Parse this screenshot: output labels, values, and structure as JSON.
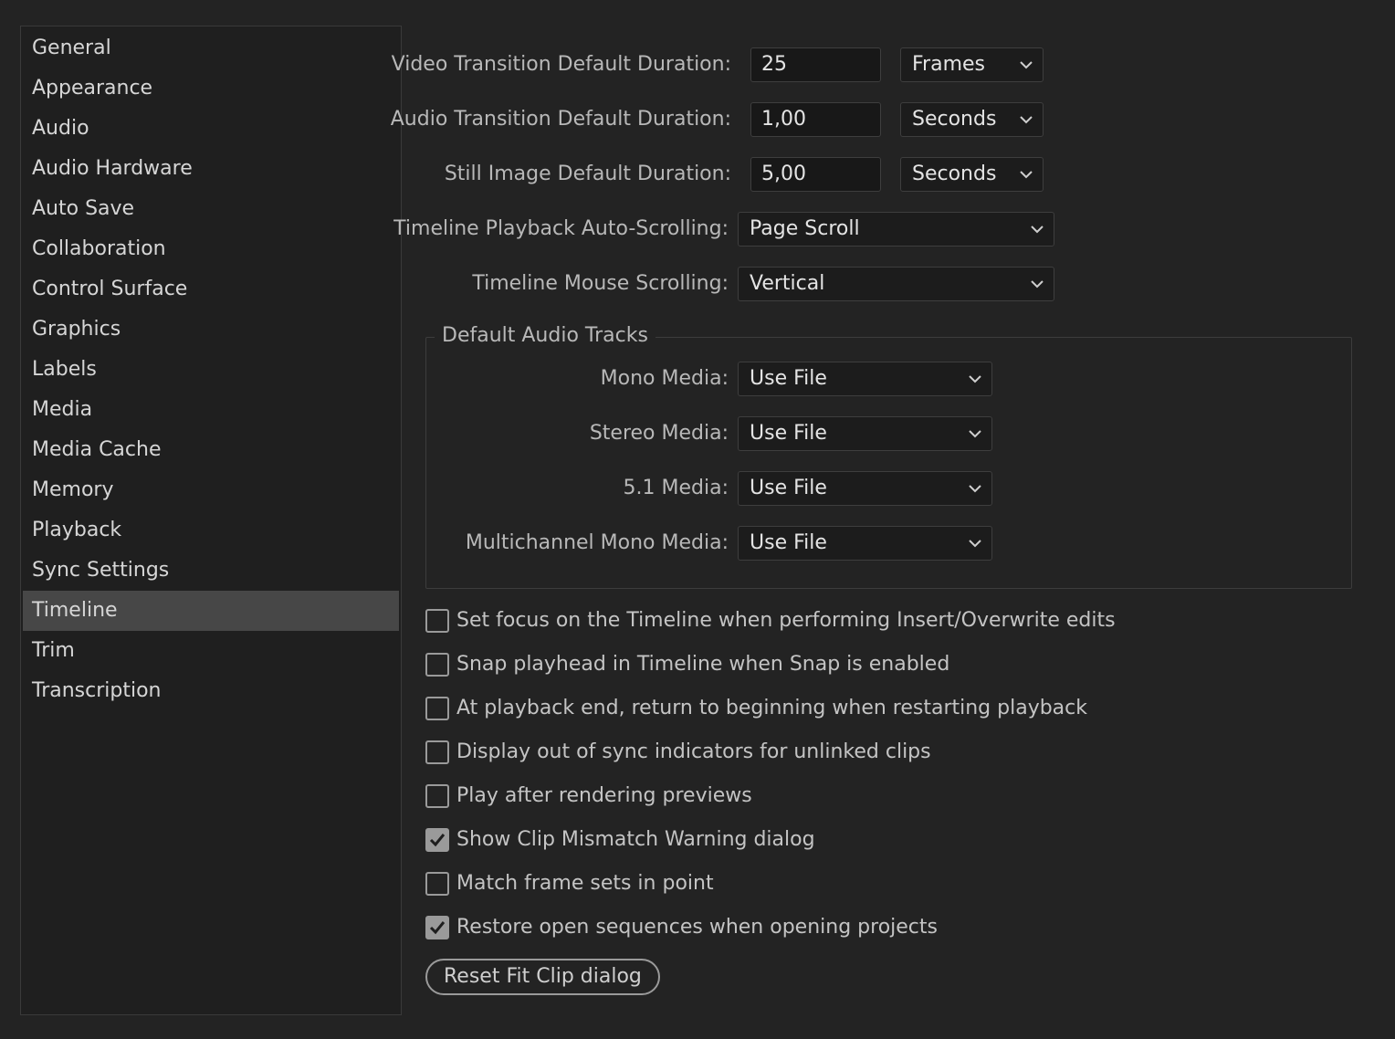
{
  "sidebar": {
    "items": [
      {
        "label": "General"
      },
      {
        "label": "Appearance"
      },
      {
        "label": "Audio"
      },
      {
        "label": "Audio Hardware"
      },
      {
        "label": "Auto Save"
      },
      {
        "label": "Collaboration"
      },
      {
        "label": "Control Surface"
      },
      {
        "label": "Graphics"
      },
      {
        "label": "Labels"
      },
      {
        "label": "Media"
      },
      {
        "label": "Media Cache"
      },
      {
        "label": "Memory"
      },
      {
        "label": "Playback"
      },
      {
        "label": "Sync Settings"
      },
      {
        "label": "Timeline",
        "selected": true
      },
      {
        "label": "Trim"
      },
      {
        "label": "Transcription"
      }
    ]
  },
  "durations": {
    "video": {
      "label": "Video Transition Default Duration:",
      "value": "25",
      "unit": "Frames"
    },
    "audio": {
      "label": "Audio Transition Default Duration:",
      "value": "1,00",
      "unit": "Seconds"
    },
    "still": {
      "label": "Still Image Default Duration:",
      "value": "5,00",
      "unit": "Seconds"
    }
  },
  "scrolling": {
    "playback": {
      "label": "Timeline Playback Auto-Scrolling:",
      "value": "Page Scroll"
    },
    "mouse": {
      "label": "Timeline Mouse Scrolling:",
      "value": "Vertical"
    }
  },
  "audio_tracks": {
    "title": "Default Audio Tracks",
    "mono": {
      "label": "Mono Media:",
      "value": "Use File"
    },
    "stereo": {
      "label": "Stereo Media:",
      "value": "Use File"
    },
    "five_one": {
      "label": "5.1 Media:",
      "value": "Use File"
    },
    "multichannel": {
      "label": "Multichannel Mono Media:",
      "value": "Use File"
    }
  },
  "options": [
    {
      "label": "Set focus on the Timeline when performing Insert/Overwrite edits",
      "checked": false
    },
    {
      "label": "Snap playhead in Timeline when Snap is enabled",
      "checked": false
    },
    {
      "label": "At playback end, return to beginning when restarting playback",
      "checked": false
    },
    {
      "label": "Display out of sync indicators for unlinked clips",
      "checked": false
    },
    {
      "label": "Play after rendering previews",
      "checked": false
    },
    {
      "label": "Show Clip Mismatch Warning dialog",
      "checked": true
    },
    {
      "label": "Match frame sets in point",
      "checked": false
    },
    {
      "label": "Restore open sequences when opening projects",
      "checked": true
    }
  ],
  "reset_button": {
    "label": "Reset Fit Clip dialog"
  },
  "icons": {
    "dropdown": "chevron-down-icon",
    "check": "checkmark-icon"
  },
  "colors": {
    "background": "#232323",
    "selected": "#474747",
    "checkbox": "#9a9a9a"
  }
}
